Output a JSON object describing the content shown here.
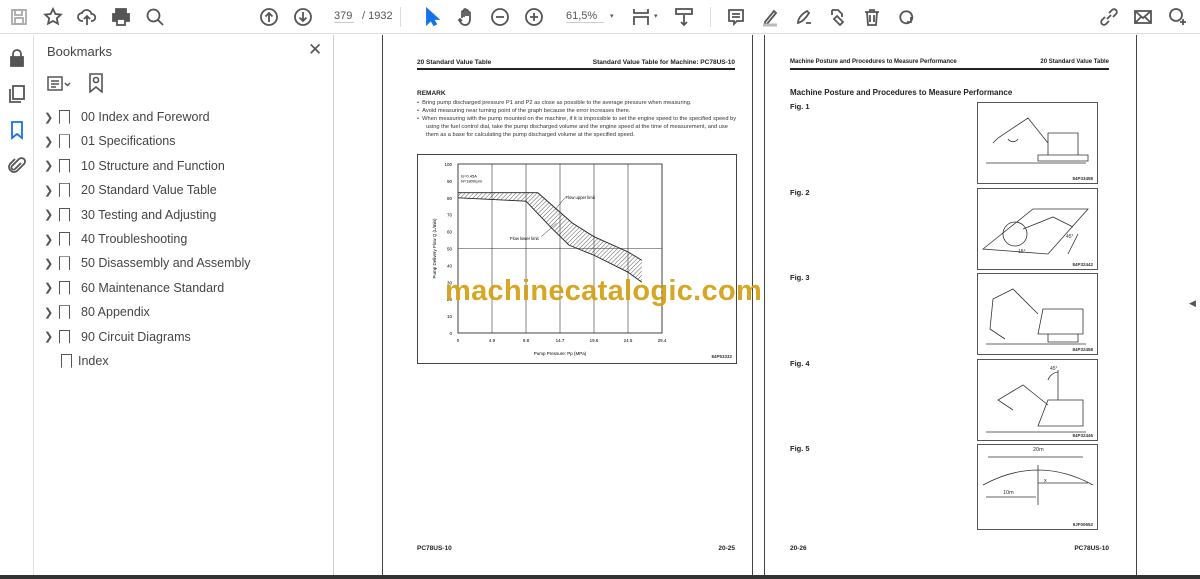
{
  "toolbar": {
    "page_current": "379",
    "page_total": "/ 1932",
    "zoom": "61,5%",
    "icons": [
      "save-icon",
      "star-icon",
      "cloud-upload-icon",
      "print-icon",
      "search-icon",
      "page-up-icon",
      "page-down-icon",
      "select-cursor-icon",
      "hand-icon",
      "zoom-out-icon",
      "zoom-in-icon",
      "fit-page-icon",
      "scroll-mode-icon",
      "comment-icon",
      "highlight-icon",
      "sign-icon",
      "share-icon",
      "delete-icon",
      "rotate-icon",
      "link-icon",
      "mail-icon",
      "add-user-icon"
    ]
  },
  "sidebar": {
    "title": "Bookmarks",
    "items": [
      {
        "label": "00 Index and Foreword",
        "expandable": true
      },
      {
        "label": "01 Specifications",
        "expandable": true
      },
      {
        "label": "10 Structure and Function",
        "expandable": true
      },
      {
        "label": "20 Standard Value Table",
        "expandable": true
      },
      {
        "label": "30 Testing and Adjusting",
        "expandable": true
      },
      {
        "label": "40 Troubleshooting",
        "expandable": true
      },
      {
        "label": "50 Disassembly and Assembly",
        "expandable": true
      },
      {
        "label": "60 Maintenance Standard",
        "expandable": true
      },
      {
        "label": "80 Appendix",
        "expandable": true
      },
      {
        "label": "90 Circuit Diagrams",
        "expandable": true
      },
      {
        "label": "Index",
        "expandable": false
      }
    ]
  },
  "page_left": {
    "header_left": "20 Standard Value Table",
    "header_right": "Standard Value Table for Machine: PC78US-10",
    "remark_title": "REMARK",
    "remarks": [
      "Bring pump discharged pressure P1 and P2 as close as possible to the average pressure when measuring.",
      "Avoid measuring near turning point of the graph because the error increases there.",
      "When measuring with the pump mounted on the machine, if it is impossible to set the engine speed to the specified speed by using the fuel control dial, take the pump discharged volume and the engine speed at the time of measurement, and use them as a base for calculating the pump discharged volume at the specified speed."
    ],
    "footer_left": "PC78US-10",
    "footer_right": "20-25",
    "figure_code": "84P53332"
  },
  "chart_data": {
    "type": "area",
    "title": "",
    "xlabel": "Pump Pressure: Pp (MPa)",
    "ylabel": "Pump Delivery Flow Q (L/min)",
    "xlim": [
      0,
      29.4
    ],
    "ylim": [
      0,
      100
    ],
    "xticks": [
      "0",
      "4.9",
      "9.8",
      "14.7",
      "19.6",
      "24.5",
      "29.4"
    ],
    "yticks": [
      "0",
      "10",
      "20",
      "30",
      "40",
      "50",
      "60",
      "70",
      "80",
      "90",
      "100"
    ],
    "condition": [
      "Is=0.45A",
      "N=1800rpm"
    ],
    "series": [
      {
        "name": "Flow upper limit",
        "x": [
          0,
          11.5,
          16.5,
          19.6,
          24.5,
          26.5
        ],
        "y": [
          83,
          83,
          65,
          57,
          48,
          43
        ]
      },
      {
        "name": "Flow lower limit",
        "x": [
          0,
          9.8,
          13.5,
          16,
          19.6,
          24.5,
          26.5
        ],
        "y": [
          80,
          78,
          62,
          52,
          46,
          36,
          30
        ]
      }
    ],
    "grid": true
  },
  "page_right": {
    "header_left": "Machine Posture and Procedures to Measure Performance",
    "header_right": "20 Standard Value Table",
    "title": "Machine Posture and Procedures to Measure Performance",
    "figures": [
      {
        "label": "Fig. 1",
        "code": "84P33458"
      },
      {
        "label": "Fig. 2",
        "code": "84P32442",
        "angles": [
          "45°",
          "15°"
        ]
      },
      {
        "label": "Fig. 3",
        "code": "84P32458"
      },
      {
        "label": "Fig. 4",
        "code": "84P32446",
        "angles": [
          "45°"
        ]
      },
      {
        "label": "Fig. 5",
        "code": "9JF00652",
        "dims": [
          "20m",
          "10m",
          "x"
        ]
      }
    ],
    "footer_left": "20-26",
    "footer_right": "PC78US-10"
  },
  "watermark": "machinecatalogic.com",
  "colors": {
    "accent": "#1473e6",
    "watermark": "#d4a21a"
  }
}
